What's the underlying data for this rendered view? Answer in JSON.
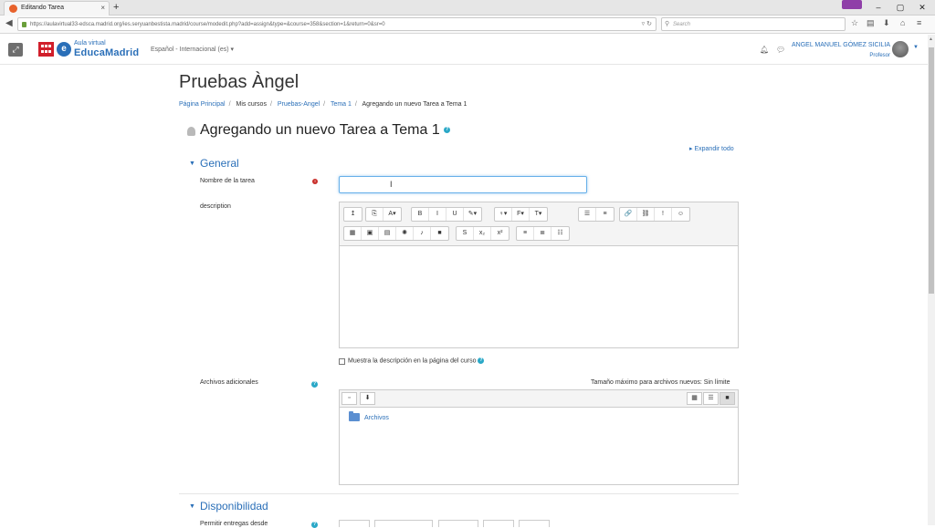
{
  "browser": {
    "tab_title": "Editando Tarea",
    "tab_close": "×",
    "new_tab": "+",
    "url": "https://aulavirtual33-edsca.madrid.org/ies.seryuanbestista.madrid/course/modedit.php?add=assign&type=&course=358&section=1&return=0&sr=0",
    "search_placeholder": "Search",
    "win_min": "–",
    "win_max": "▢",
    "win_close": "✕"
  },
  "header": {
    "logo_small": "Aula virtual",
    "logo_big": "EducaMadrid",
    "logo_e": "e",
    "language": "Español - Internacional (es) ▾",
    "user_name": "ANGEL MANUEL GÓMEZ SICILIA",
    "user_role": "Profesor"
  },
  "page": {
    "title": "Pruebas Àngel",
    "breadcrumb": [
      "Página Principal",
      "Mis cursos",
      "Pruebas-Angel",
      "Tema 1",
      "Agregando un nuevo Tarea a Tema 1"
    ],
    "heading": "Agregando un nuevo Tarea a Tema 1",
    "expand_all": "Expandir todo"
  },
  "sections": {
    "general": "General",
    "availability": "Disponibilidad"
  },
  "form": {
    "name_label": "Nombre de la tarea",
    "description_label": "description",
    "show_description": "Muestra la descripción en la página del curso",
    "files_label": "Archivos adicionales",
    "max_size": "Tamaño máximo para archivos nuevos: Sin límite",
    "folder": "Archivos",
    "allow_from": "Permitir entregas desde"
  },
  "editor_toolbar": {
    "row1": [
      [
        "↥"
      ],
      [
        "⎘",
        "A▾"
      ],
      [
        "B",
        "I",
        "U",
        "✎▾"
      ],
      [
        "♀▾",
        "F▾",
        "T▾"
      ],
      [
        "☰",
        "≡"
      ],
      [
        "🔗",
        "⛓",
        "!",
        "☺"
      ]
    ],
    "row2": [
      [
        "▦",
        "▣",
        "▤",
        "✺",
        "♪",
        "■"
      ],
      [
        "S",
        "x₂",
        "x²"
      ],
      [
        "≡",
        "≣",
        "☷"
      ]
    ]
  },
  "icons": {
    "required": "!",
    "help": "?"
  }
}
